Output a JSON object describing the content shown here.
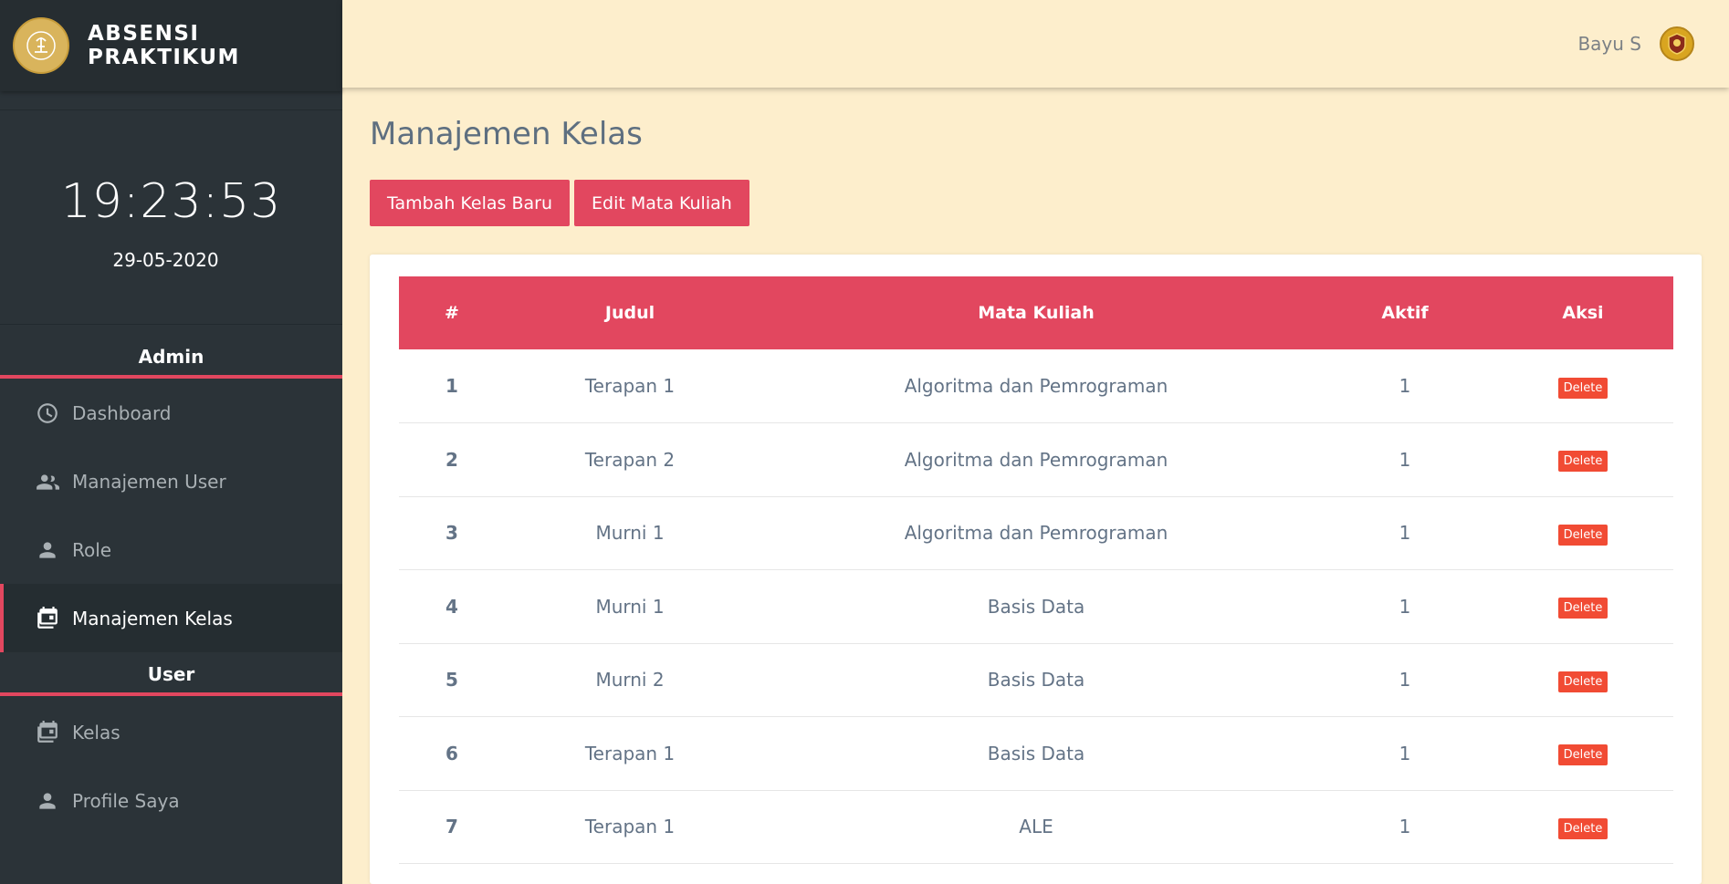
{
  "brand": {
    "title_line1": "ABSENSI",
    "title_line2": "PRAKTIKUM",
    "logo_icon": "university-logo-icon"
  },
  "clock": {
    "time": "19:23:53",
    "date": "29-05-2020"
  },
  "sidebar": {
    "admin_header": "Admin",
    "admin_items": [
      {
        "label": "Dashboard",
        "icon": "dashboard-icon"
      },
      {
        "label": "Manajemen User",
        "icon": "users-icon"
      },
      {
        "label": "Role",
        "icon": "person-icon"
      },
      {
        "label": "Manajemen Kelas",
        "icon": "calendar-stack-icon",
        "active": true
      }
    ],
    "user_header": "User",
    "user_items": [
      {
        "label": "Kelas",
        "icon": "calendar-stack-icon"
      },
      {
        "label": "Profile Saya",
        "icon": "person-icon"
      }
    ]
  },
  "topbar": {
    "user_name": "Bayu S",
    "avatar_icon": "emblem-avatar-icon"
  },
  "main": {
    "title": "Manajemen Kelas",
    "add_button": "Tambah Kelas Baru",
    "edit_button": "Edit Mata Kuliah"
  },
  "table": {
    "headers": [
      "#",
      "Judul",
      "Mata Kuliah",
      "Aktif",
      "Aksi"
    ],
    "delete_label": "Delete",
    "rows": [
      {
        "no": "1",
        "judul": "Terapan 1",
        "matkul": "Algoritma dan Pemrograman",
        "aktif": "1"
      },
      {
        "no": "2",
        "judul": "Terapan 2",
        "matkul": "Algoritma dan Pemrograman",
        "aktif": "1"
      },
      {
        "no": "3",
        "judul": "Murni 1",
        "matkul": "Algoritma dan Pemrograman",
        "aktif": "1"
      },
      {
        "no": "4",
        "judul": "Murni 1",
        "matkul": "Basis Data",
        "aktif": "1"
      },
      {
        "no": "5",
        "judul": "Murni 2",
        "matkul": "Basis Data",
        "aktif": "1"
      },
      {
        "no": "6",
        "judul": "Terapan 1",
        "matkul": "Basis Data",
        "aktif": "1"
      },
      {
        "no": "7",
        "judul": "Terapan 1",
        "matkul": "ALE",
        "aktif": "1"
      }
    ]
  },
  "colors": {
    "accent": "#e2475f",
    "sidebar_bg": "#2b3338",
    "page_bg": "#fdeecc",
    "delete": "#f14b34"
  }
}
